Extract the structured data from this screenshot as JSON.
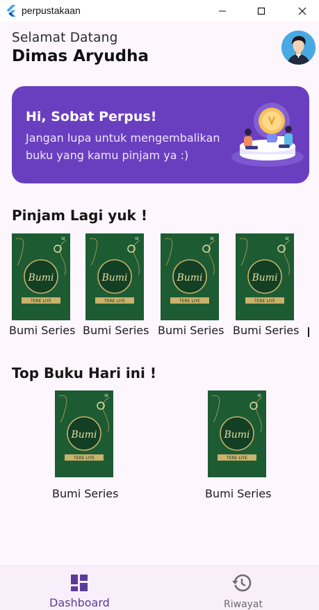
{
  "window": {
    "title": "perpustakaan",
    "icons": [
      "flutter-icon",
      "minimize-icon",
      "maximize-icon",
      "close-icon"
    ]
  },
  "header": {
    "greeting": "Selamat Datang",
    "username": "Dimas Aryudha"
  },
  "banner": {
    "title": "Hi, Sobat Perpus!",
    "text": "Jangan lupa untuk mengembalikan buku yang kamu pinjam ya :)",
    "color": "#6a3fbf"
  },
  "borrow_again": {
    "title": "Pinjam Lagi yuk !",
    "books": [
      {
        "label": "Bumi Series"
      },
      {
        "label": "Bumi Series"
      },
      {
        "label": "Bumi Series"
      },
      {
        "label": "Bumi Series"
      }
    ]
  },
  "top_books": {
    "title": "Top Buku Hari ini !",
    "books": [
      {
        "label": "Bumi Series"
      },
      {
        "label": "Bumi Series"
      }
    ]
  },
  "cover_text": {
    "title": "Bumi",
    "author": "TERE LIYE",
    "publisher": "GI"
  },
  "bottom_nav": {
    "items": [
      {
        "label": "Dashboard",
        "icon": "dashboard-icon",
        "active": true
      },
      {
        "label": "Riwayat",
        "icon": "history-icon",
        "active": false
      }
    ],
    "active_color": "#5b3a9c",
    "inactive_color": "#6f6a73"
  }
}
